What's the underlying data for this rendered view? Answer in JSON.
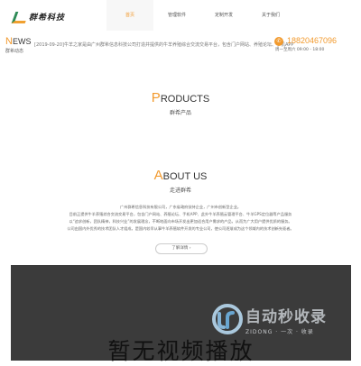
{
  "header": {
    "logo_text": "群希科技",
    "nav": [
      {
        "label": "首页",
        "active": true
      },
      {
        "label": "管理软件",
        "active": false
      },
      {
        "label": "定制开发",
        "active": false
      },
      {
        "label": "关于我们",
        "active": false
      }
    ]
  },
  "news": {
    "title_first": "N",
    "title_rest": "EWS",
    "subtitle": "群希动态",
    "item": "[2019-09-20]牛羊之家是由广州群希信息科技公司打造并提供的牛羊养殖综合交流交易平台，包含门户网站、养殖论坛、手机APP"
  },
  "contact": {
    "phone_icon": "phone-icon",
    "phone": "18820467096",
    "hours": "周一至周六 09:00 - 18:00"
  },
  "products": {
    "title_first": "P",
    "title_rest": "RODUCTS",
    "subtitle": "群希产品"
  },
  "about": {
    "title_first": "A",
    "title_rest": "BOUT US",
    "subtitle": "走进群希",
    "lines": [
      "广州群希信息科技有限公司，广东省政府扶持企业，广州市创新型企业。",
      "目前正提供牛羊养殖综合交流交易平台，包含门户网站、养殖论坛、手机APP、此外牛羊养殖云管理平台、牛羊GPS定位器等产品服务",
      "以“追求创新，团队精神，科技兴业”的发展理念，不断地面向市场开发出更加适合用户需求的产品，从而为广大用户提供优质的服务。",
      "公司由国内外优秀的技术团队人才组成，是国内较早从事牛羊养殖软件开发的专业公司，使公司逐渐成为这个领域内的技术创新先驱者。"
    ],
    "more_label": "了解详情 ›"
  },
  "video": {
    "message": "暂无视频播放"
  },
  "watermark": {
    "title": "自动秒收录",
    "subtitle": "ZIDONG · 一次 · 收录"
  }
}
